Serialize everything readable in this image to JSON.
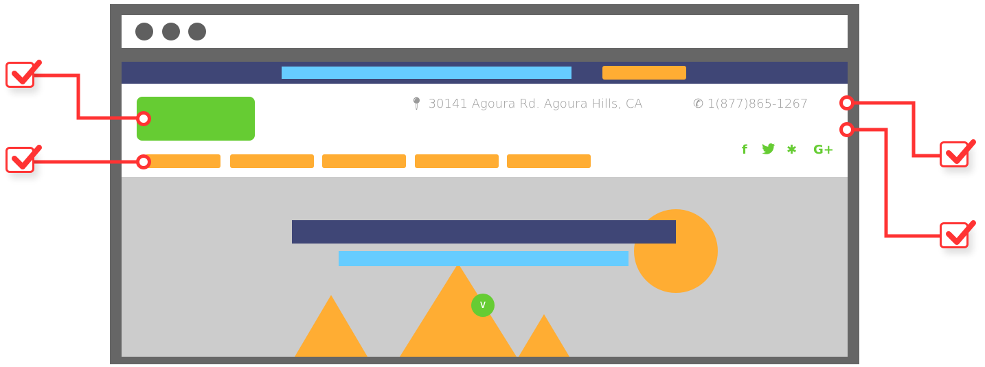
{
  "header": {
    "address": "30141 Agoura Rd. Agoura Hills, CA",
    "phone": "1(877)865-1267"
  },
  "social": [
    {
      "name": "facebook-icon",
      "glyph": "f"
    },
    {
      "name": "twitter-icon",
      "glyph": "🐦"
    },
    {
      "name": "yelp-icon",
      "glyph": "✱"
    },
    {
      "name": "google-plus-icon",
      "glyph": "G+"
    }
  ],
  "colors": {
    "frame": "#666666",
    "topbar": "#3f4676",
    "accent_blue": "#66ccff",
    "accent_orange": "#ffad33",
    "accent_green": "#66cc33",
    "hero_bg": "#cccccc",
    "callout_red": "#ff3333"
  },
  "hero": {
    "scroll_button_glyph": "∨"
  }
}
